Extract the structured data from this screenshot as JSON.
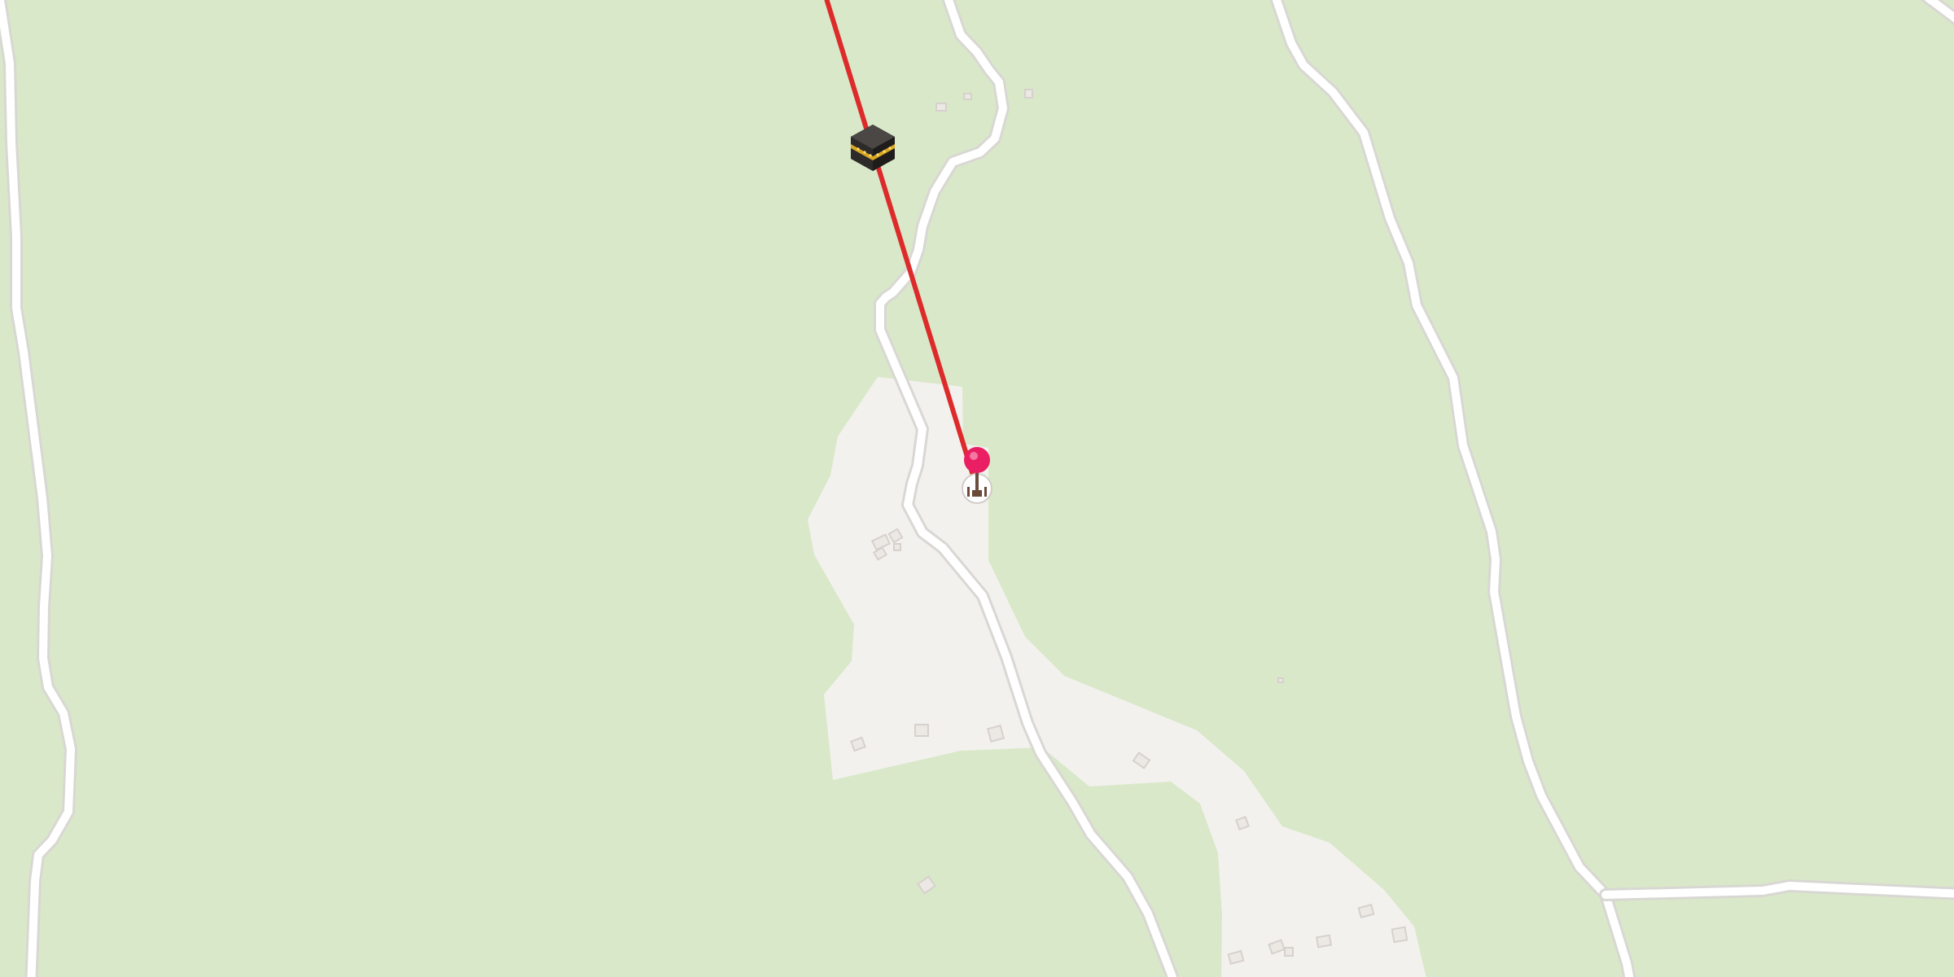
{
  "map": {
    "background_color": "#d9e8c9",
    "settlement_fill": "#f3f1ee",
    "road_color": "#ffffff",
    "qibla_line_color": "#dd2a2a",
    "markers": {
      "kaaba": {
        "icon": "kaaba-icon"
      },
      "location_pin": {
        "icon": "map-pin-icon",
        "color": "#e91e63"
      },
      "mosque": {
        "icon": "mosque-icon"
      }
    },
    "roads": [
      "road-west",
      "road-central-north",
      "road-central-south",
      "road-east",
      "road-east-branch",
      "road-northeast-corner"
    ],
    "buildings_count": 18
  }
}
